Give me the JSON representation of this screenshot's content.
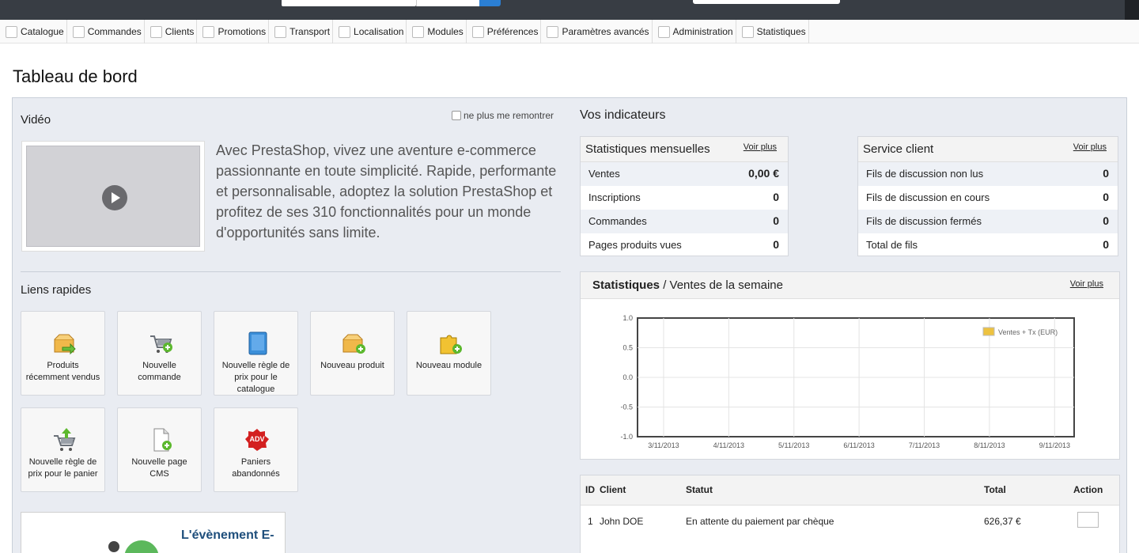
{
  "nav": {
    "items": [
      "Catalogue",
      "Commandes",
      "Clients",
      "Promotions",
      "Transport",
      "Localisation",
      "Modules",
      "Préférences",
      "Paramètres avancés",
      "Administration",
      "Statistiques"
    ]
  },
  "page_title": "Tableau de bord",
  "video": {
    "title": "Vidéo",
    "hide_option": "ne plus me remontrer",
    "text": "Avec PrestaShop, vivez une aventure e-commerce passionnante en toute simplicité. Rapide, performante et personnalisable, adoptez la solution PrestaShop et profitez de ses 310 fonctionnalités pour un monde d'opportunités sans limite."
  },
  "quick_links": {
    "title": "Liens rapides",
    "items": [
      {
        "label": "Produits récemment vendus",
        "icon": "box-arrow-icon"
      },
      {
        "label": "Nouvelle commande",
        "icon": "cart-add-icon"
      },
      {
        "label": "Nouvelle règle de prix pour le catalogue",
        "icon": "book-icon"
      },
      {
        "label": "Nouveau produit",
        "icon": "box-add-icon"
      },
      {
        "label": "Nouveau module",
        "icon": "puzzle-add-icon"
      },
      {
        "label": "Nouvelle règle de prix pour le panier",
        "icon": "cart-up-icon"
      },
      {
        "label": "Nouvelle page CMS",
        "icon": "page-add-icon"
      },
      {
        "label": "Paniers abandonnés",
        "icon": "adv-badge-icon",
        "badge": "ADV"
      }
    ]
  },
  "promo": {
    "title": "L'évènement E-"
  },
  "indicators": {
    "title": "Vos indicateurs",
    "monthly": {
      "title": "Statistiques mensuelles",
      "more": "Voir plus",
      "rows": [
        {
          "label": "Ventes",
          "value": "0,00 €"
        },
        {
          "label": "Inscriptions",
          "value": "0"
        },
        {
          "label": "Commandes",
          "value": "0"
        },
        {
          "label": "Pages produits vues",
          "value": "0"
        }
      ]
    },
    "service": {
      "title": "Service client",
      "more": "Voir plus",
      "rows": [
        {
          "label": "Fils de discussion non lus",
          "value": "0"
        },
        {
          "label": "Fils de discussion en cours",
          "value": "0"
        },
        {
          "label": "Fils de discussion fermés",
          "value": "0"
        },
        {
          "label": "Total de fils",
          "value": "0"
        }
      ]
    }
  },
  "stats": {
    "title_bold": "Statistiques",
    "title_rest": " / Ventes de la semaine",
    "more": "Voir plus"
  },
  "chart_data": {
    "type": "line",
    "x": [
      "3/11/2013",
      "4/11/2013",
      "5/11/2013",
      "6/11/2013",
      "7/11/2013",
      "8/11/2013",
      "9/11/2013"
    ],
    "yticks": [
      "1.0",
      "0.5",
      "0.0",
      "-0.5",
      "-1.0"
    ],
    "ylim": [
      -1,
      1
    ],
    "series": [
      {
        "name": "Ventes + Tx (EUR)",
        "values": [],
        "color": "#edc240"
      }
    ],
    "legend": "top-right",
    "grid": true
  },
  "orders": {
    "headers": {
      "id": "ID",
      "client": "Client",
      "status": "Statut",
      "total": "Total",
      "action": "Action"
    },
    "rows": [
      {
        "id": "1",
        "client": "John DOE",
        "status": "En attente du paiement par chèque",
        "total": "626,37 €"
      }
    ]
  }
}
